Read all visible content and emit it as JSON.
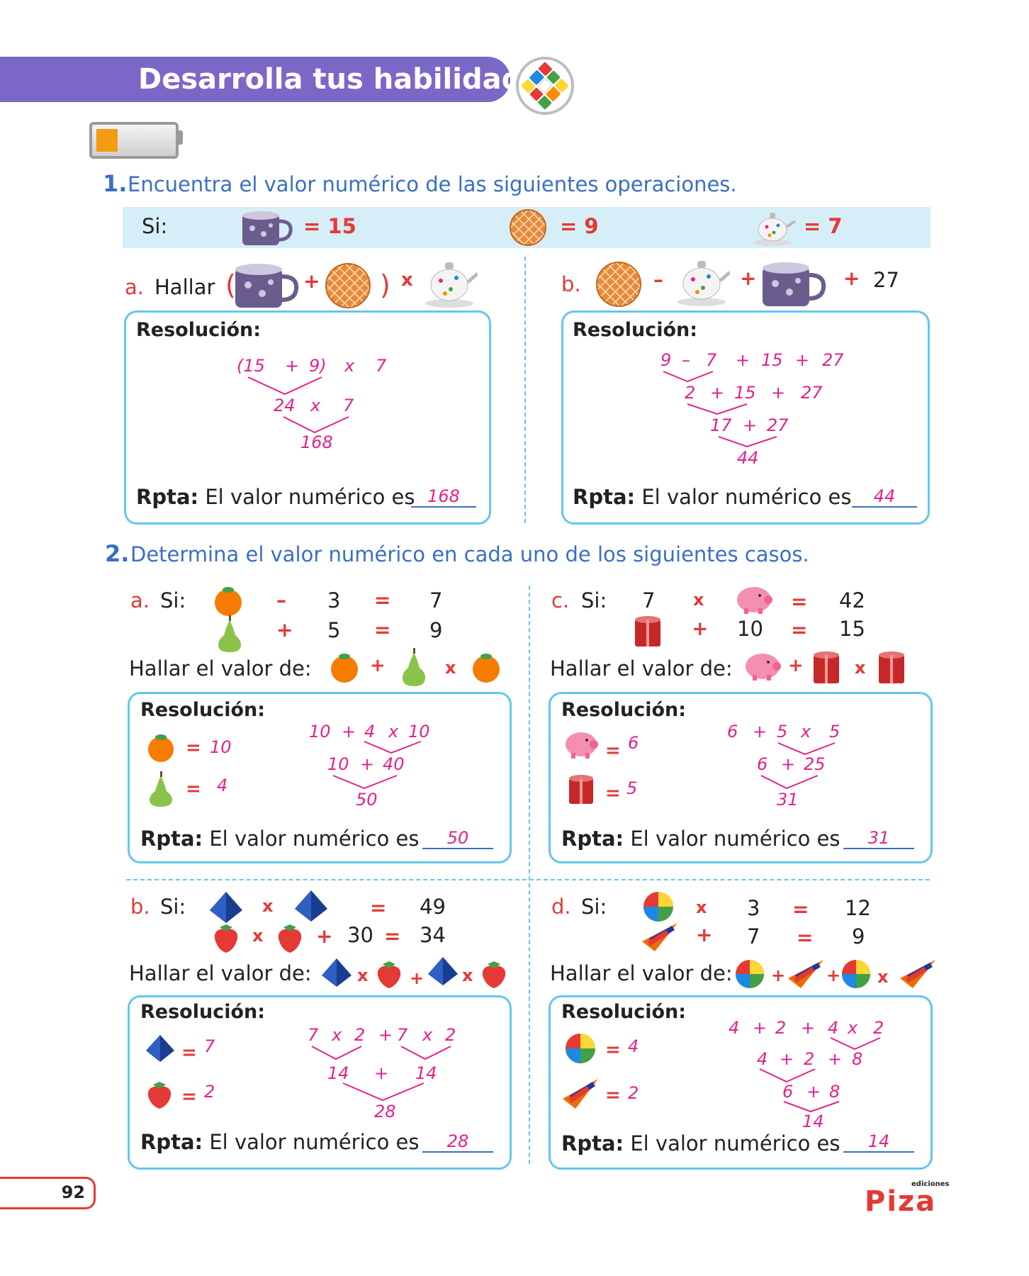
{
  "header": {
    "title": "Desarrolla tus habilidades"
  },
  "q1": {
    "number": "1.",
    "text": "Encuentra el valor numérico de las siguientes operaciones.",
    "given": {
      "si": "Si:",
      "cup_val": "= 15",
      "pie_val": "= 9",
      "teapot_val": "= 7"
    },
    "a": {
      "letter": "a.",
      "word": "Hallar",
      "open": "(",
      "plus": "+",
      "close": ")",
      "times": "x",
      "res_title": "Resolución:",
      "work": [
        "(15",
        "+",
        "9)",
        "x",
        "7",
        "24",
        "x",
        "7",
        "168"
      ],
      "rpta_label": "Rpta:",
      "rpta_text": "El valor numérico es",
      "answer": "168"
    },
    "b": {
      "letter": "b.",
      "minus": "–",
      "plus1": "+",
      "plus2": "+",
      "const": "27",
      "res_title": "Resolución:",
      "work": [
        "9",
        "–",
        "7",
        "+",
        "15",
        "+",
        "27",
        "2",
        "+",
        "15",
        "+",
        "27",
        "17",
        "+",
        "27",
        "44"
      ],
      "rpta_label": "Rpta:",
      "rpta_text": "El valor numérico es",
      "answer": "44"
    }
  },
  "q2": {
    "number": "2.",
    "text": "Determina el valor numérico en cada uno de los siguientes casos.",
    "a": {
      "letter": "a.",
      "si": "Si:",
      "eq1": {
        "op": "–",
        "n": "3",
        "eq": "=",
        "r": "7"
      },
      "eq2": {
        "op": "+",
        "n": "5",
        "eq": "=",
        "r": "9"
      },
      "find": "Hallar el valor de:",
      "fop1": "+",
      "fop2": "x",
      "res_title": "Resolución:",
      "vals": {
        "eq": "=",
        "orange": "10",
        "pear": "4"
      },
      "work": [
        "10",
        "+",
        "4",
        "x",
        "10",
        "10",
        "+",
        "40",
        "50"
      ],
      "rpta_label": "Rpta:",
      "rpta_text": "El valor numérico es",
      "answer": "50"
    },
    "b": {
      "letter": "b.",
      "si": "Si:",
      "eq1": {
        "op": "x",
        "eq": "=",
        "r": "49"
      },
      "eq2": {
        "op1": "x",
        "op2": "+",
        "n": "30",
        "eq": "=",
        "r": "34"
      },
      "find": "Hallar el valor de:",
      "fop1": "x",
      "fop2": "+",
      "fop3": "x",
      "res_title": "Resolución:",
      "vals": {
        "eq": "=",
        "pyramid": "7",
        "strawberry": "2"
      },
      "work": [
        "7",
        "x",
        "2",
        "+",
        "7",
        "x",
        "2",
        "14",
        "+",
        "14",
        "28"
      ],
      "rpta_label": "Rpta:",
      "rpta_text": "El valor numérico es",
      "answer": "28"
    },
    "c": {
      "letter": "c.",
      "si": "Si:",
      "eq1": {
        "n": "7",
        "op": "x",
        "eq": "=",
        "r": "42"
      },
      "eq2": {
        "op": "+",
        "n": "10",
        "eq": "=",
        "r": "15"
      },
      "find": "Hallar el valor de:",
      "fop1": "+",
      "fop2": "x",
      "res_title": "Resolución:",
      "vals": {
        "eq": "=",
        "pig": "6",
        "box": "5"
      },
      "work": [
        "6",
        "+",
        "5",
        "x",
        "5",
        "6",
        "+",
        "25",
        "31"
      ],
      "rpta_label": "Rpta:",
      "rpta_text": "El valor numérico es",
      "answer": "31"
    },
    "d": {
      "letter": "d.",
      "si": "Si:",
      "eq1": {
        "op": "x",
        "n": "3",
        "eq": "=",
        "r": "12"
      },
      "eq2": {
        "op": "+",
        "n": "7",
        "eq": "=",
        "r": "9"
      },
      "find": "Hallar el valor de:",
      "fop1": "+",
      "fop2": "+",
      "fop3": "x",
      "res_title": "Resolución:",
      "vals": {
        "eq": "=",
        "ball": "4",
        "top": "2"
      },
      "work": [
        "4",
        "+",
        "2",
        "+",
        "4",
        "x",
        "2",
        "4",
        "+",
        "2",
        "+",
        "8",
        "6",
        "+",
        "8",
        "14"
      ],
      "rpta_label": "Rpta:",
      "rpta_text": "El valor numérico es",
      "answer": "14"
    }
  },
  "footer": {
    "page": "92",
    "brand_small": "ediciones",
    "brand": "Piza"
  }
}
